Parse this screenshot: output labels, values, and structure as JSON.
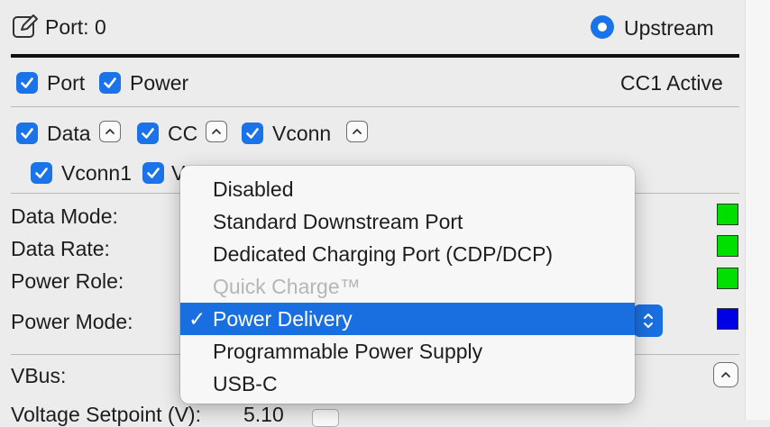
{
  "header": {
    "port_label": "Port: 0",
    "upstream_label": "Upstream"
  },
  "row1": {
    "port_label": "Port",
    "power_label": "Power",
    "status": "CC1 Active"
  },
  "row2": {
    "data_label": "Data",
    "cc_label": "CC",
    "vconn_label": "Vconn"
  },
  "row3": {
    "vconn1_label": "Vconn1",
    "vconn2_partial": "V"
  },
  "fields": {
    "data_mode": "Data Mode:",
    "data_rate": "Data Rate:",
    "power_role": "Power Role:",
    "power_mode": "Power Mode:",
    "vbus": "VBus:",
    "voltage_setpoint": "Voltage Setpoint (V):",
    "voltage_value": "5.10"
  },
  "indicators": {
    "data_mode_color": "#00e000",
    "data_rate_color": "#00e000",
    "power_role_color": "#00e000",
    "power_mode_color": "#0000e6"
  },
  "menu": {
    "items": [
      {
        "label": "Disabled",
        "state": "normal"
      },
      {
        "label": "Standard Downstream Port",
        "state": "normal"
      },
      {
        "label": "Dedicated Charging Port (CDP/DCP)",
        "state": "normal"
      },
      {
        "label": "Quick Charge™",
        "state": "disabled"
      },
      {
        "label": "Power Delivery",
        "state": "selected"
      },
      {
        "label": "Programmable Power Supply",
        "state": "normal"
      },
      {
        "label": "USB-C",
        "state": "normal"
      }
    ],
    "check_glyph": "✓"
  },
  "colors": {
    "accent": "#1a73e8",
    "selection": "#1a6fe0"
  }
}
